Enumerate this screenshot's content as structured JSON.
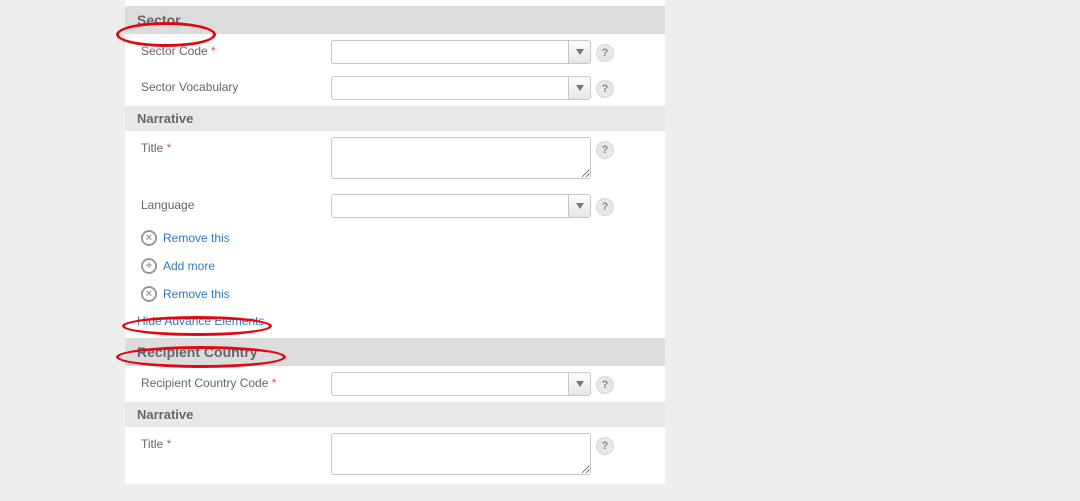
{
  "top_select": {
    "value": ""
  },
  "sector": {
    "heading": "Sector",
    "code_label": "Sector Code",
    "code_value": "",
    "vocab_label": "Sector Vocabulary",
    "vocab_value": ""
  },
  "narrative1": {
    "heading": "Narrative",
    "title_label": "Title",
    "title_value": "",
    "lang_label": "Language",
    "lang_value": "",
    "remove_inner": "Remove this",
    "add_more": "Add more",
    "remove_outer": "Remove this"
  },
  "toggle": "Hide Advance Elements",
  "recipient": {
    "heading": "Recipient Country",
    "code_label": "Recipient Country Code",
    "code_value": ""
  },
  "narrative2": {
    "heading": "Narrative",
    "title_label": "Title",
    "title_value": ""
  }
}
